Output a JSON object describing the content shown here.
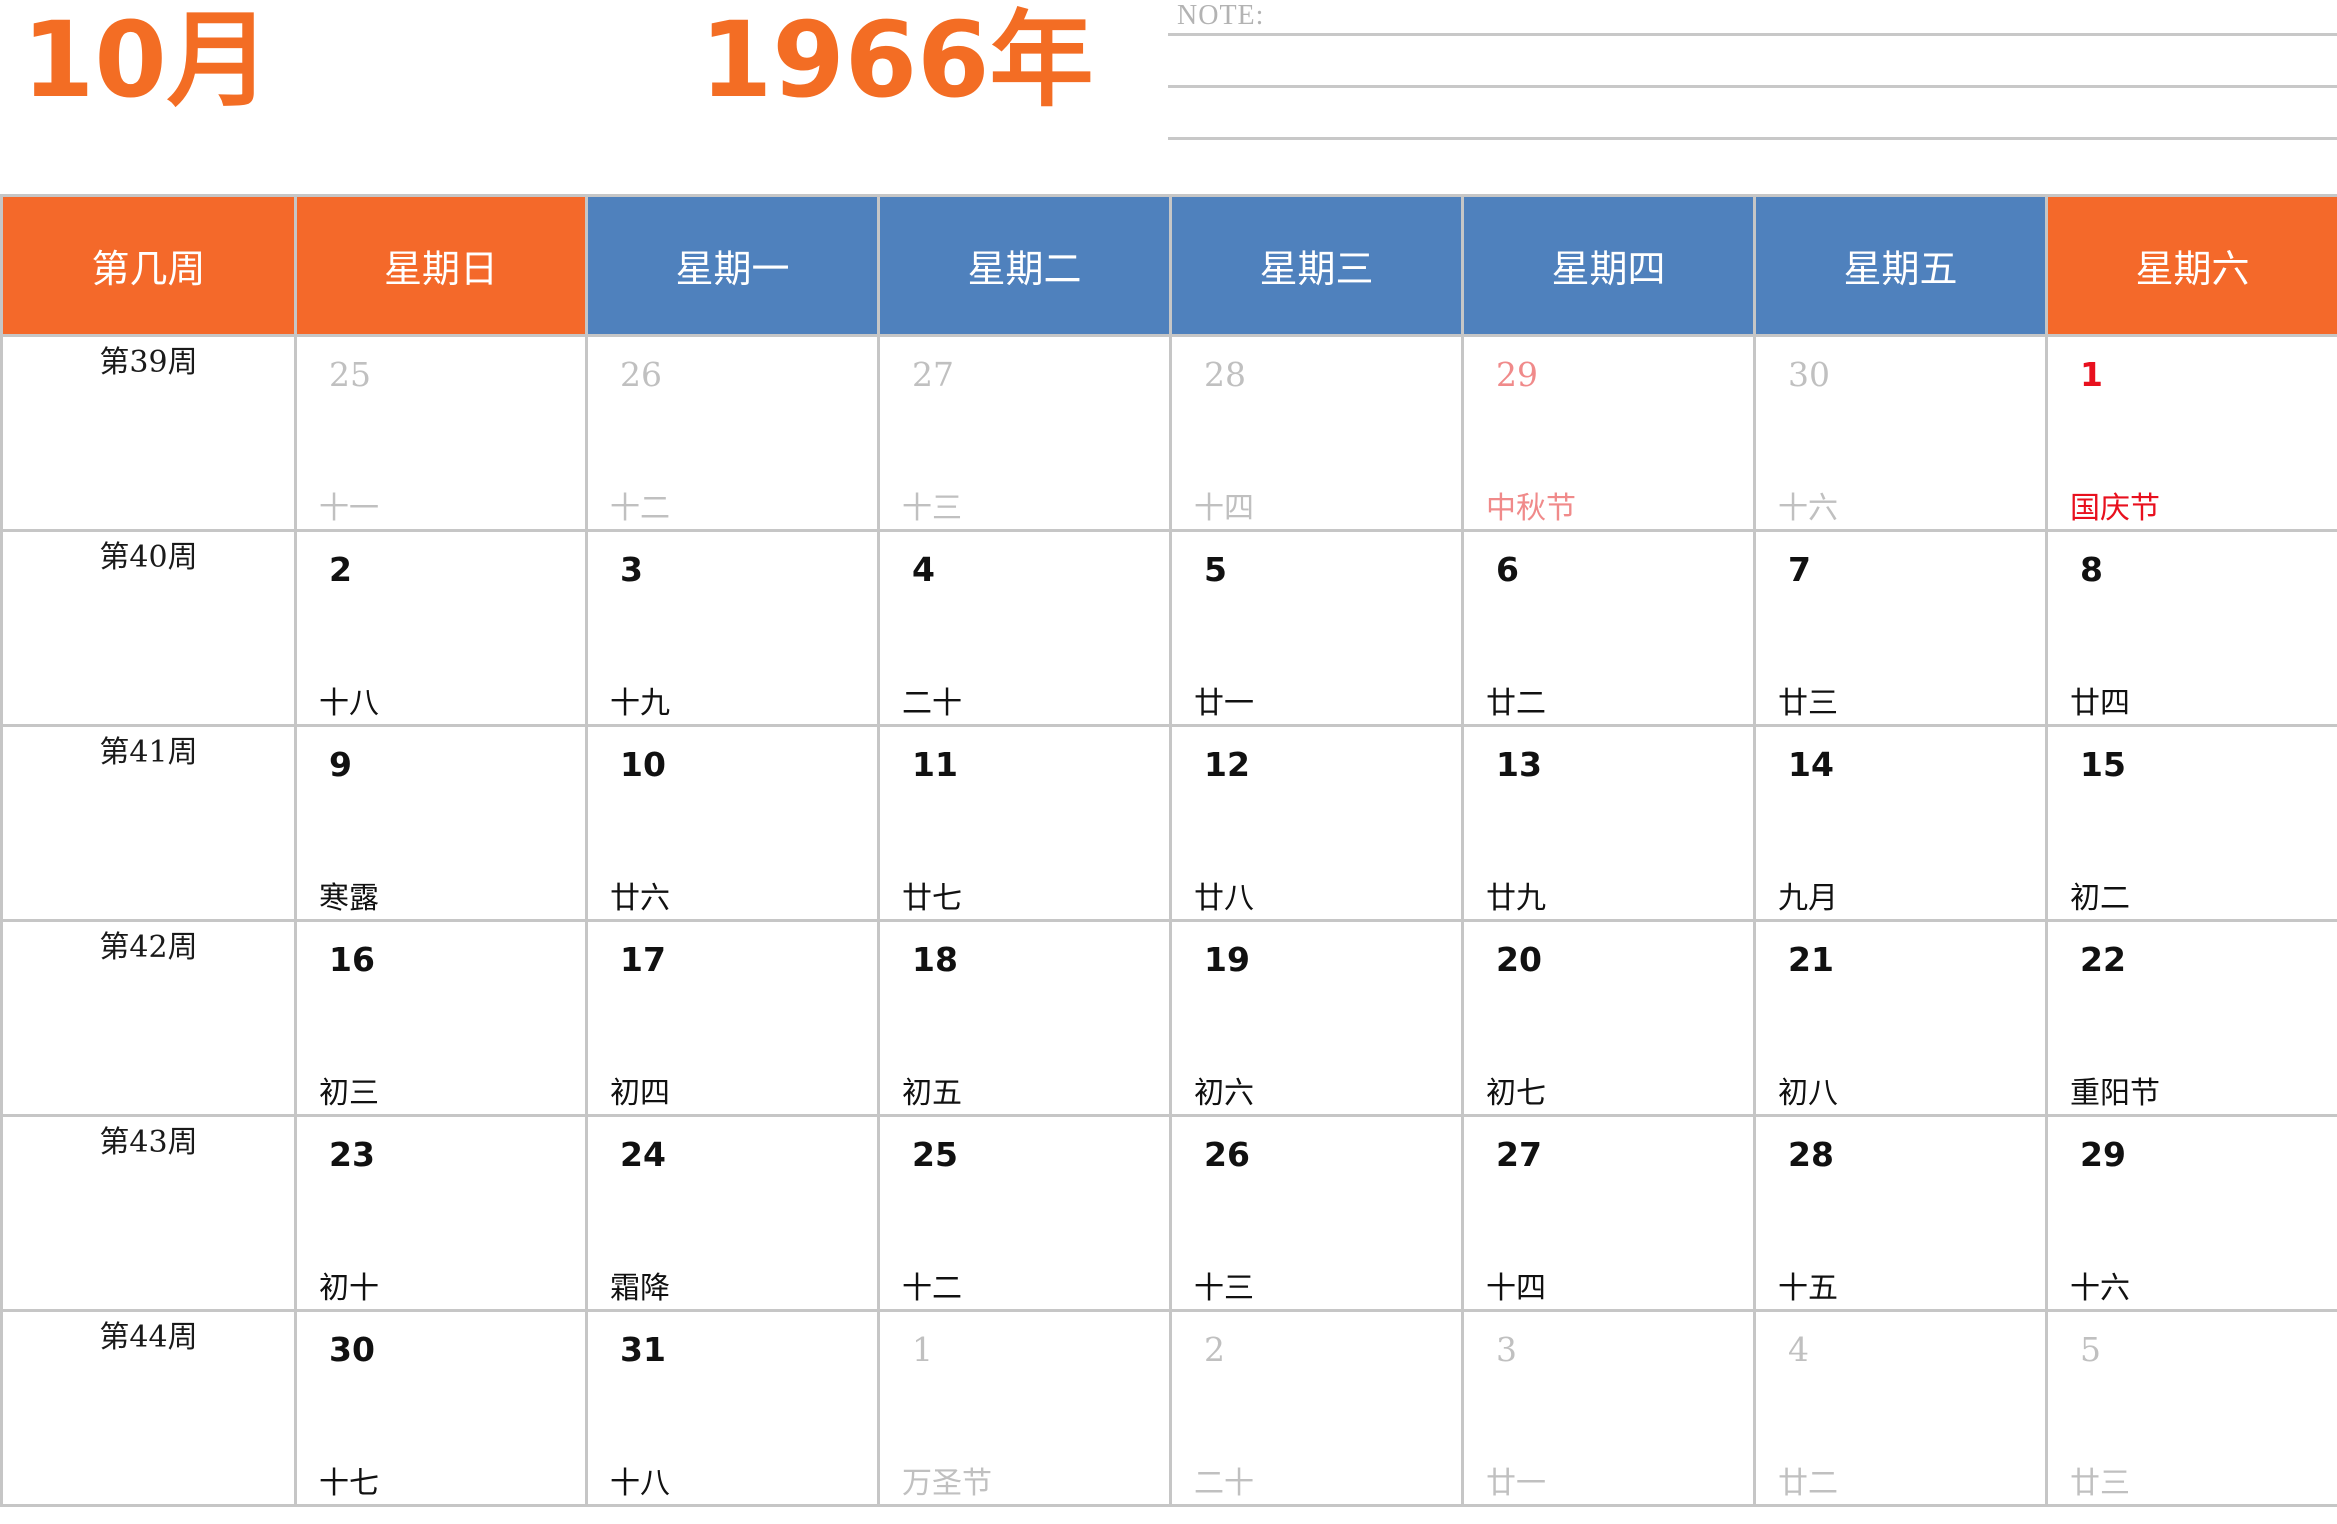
{
  "header": {
    "month": "10月",
    "year": "1966年",
    "note_label": "NOTE:"
  },
  "table": {
    "columns": [
      "第几周",
      "星期日",
      "星期一",
      "星期二",
      "星期三",
      "星期四",
      "星期五",
      "星期六"
    ],
    "rows": [
      {
        "week": "第39周",
        "days": [
          {
            "day": "25",
            "lunar": "十一"
          },
          {
            "day": "26",
            "lunar": "十二"
          },
          {
            "day": "27",
            "lunar": "十三"
          },
          {
            "day": "28",
            "lunar": "十四"
          },
          {
            "day": "29",
            "lunar": "中秋节"
          },
          {
            "day": "30",
            "lunar": "十六"
          },
          {
            "day": "1",
            "lunar": "国庆节"
          }
        ]
      },
      {
        "week": "第40周",
        "days": [
          {
            "day": "2",
            "lunar": "十八"
          },
          {
            "day": "3",
            "lunar": "十九"
          },
          {
            "day": "4",
            "lunar": "二十"
          },
          {
            "day": "5",
            "lunar": "廿一"
          },
          {
            "day": "6",
            "lunar": "廿二"
          },
          {
            "day": "7",
            "lunar": "廿三"
          },
          {
            "day": "8",
            "lunar": "廿四"
          }
        ]
      },
      {
        "week": "第41周",
        "days": [
          {
            "day": "9",
            "lunar": "寒露"
          },
          {
            "day": "10",
            "lunar": "廿六"
          },
          {
            "day": "11",
            "lunar": "廿七"
          },
          {
            "day": "12",
            "lunar": "廿八"
          },
          {
            "day": "13",
            "lunar": "廿九"
          },
          {
            "day": "14",
            "lunar": "九月"
          },
          {
            "day": "15",
            "lunar": "初二"
          }
        ]
      },
      {
        "week": "第42周",
        "days": [
          {
            "day": "16",
            "lunar": "初三"
          },
          {
            "day": "17",
            "lunar": "初四"
          },
          {
            "day": "18",
            "lunar": "初五"
          },
          {
            "day": "19",
            "lunar": "初六"
          },
          {
            "day": "20",
            "lunar": "初七"
          },
          {
            "day": "21",
            "lunar": "初八"
          },
          {
            "day": "22",
            "lunar": "重阳节"
          }
        ]
      },
      {
        "week": "第43周",
        "days": [
          {
            "day": "23",
            "lunar": "初十"
          },
          {
            "day": "24",
            "lunar": "霜降"
          },
          {
            "day": "25",
            "lunar": "十二"
          },
          {
            "day": "26",
            "lunar": "十三"
          },
          {
            "day": "27",
            "lunar": "十四"
          },
          {
            "day": "28",
            "lunar": "十五"
          },
          {
            "day": "29",
            "lunar": "十六"
          }
        ]
      },
      {
        "week": "第44周",
        "days": [
          {
            "day": "30",
            "lunar": "十七"
          },
          {
            "day": "31",
            "lunar": "十八"
          },
          {
            "day": "1",
            "lunar": "万圣节"
          },
          {
            "day": "2",
            "lunar": "二十"
          },
          {
            "day": "3",
            "lunar": "廿一"
          },
          {
            "day": "4",
            "lunar": "廿二"
          },
          {
            "day": "5",
            "lunar": "廿三"
          }
        ]
      }
    ]
  },
  "colors": {
    "accent_orange": "#f4692a",
    "header_blue": "#4f81bd",
    "holiday_red": "#e8101e",
    "muted_gray": "#c0c0c0",
    "muted_festival_pink": "#f08a8a"
  }
}
